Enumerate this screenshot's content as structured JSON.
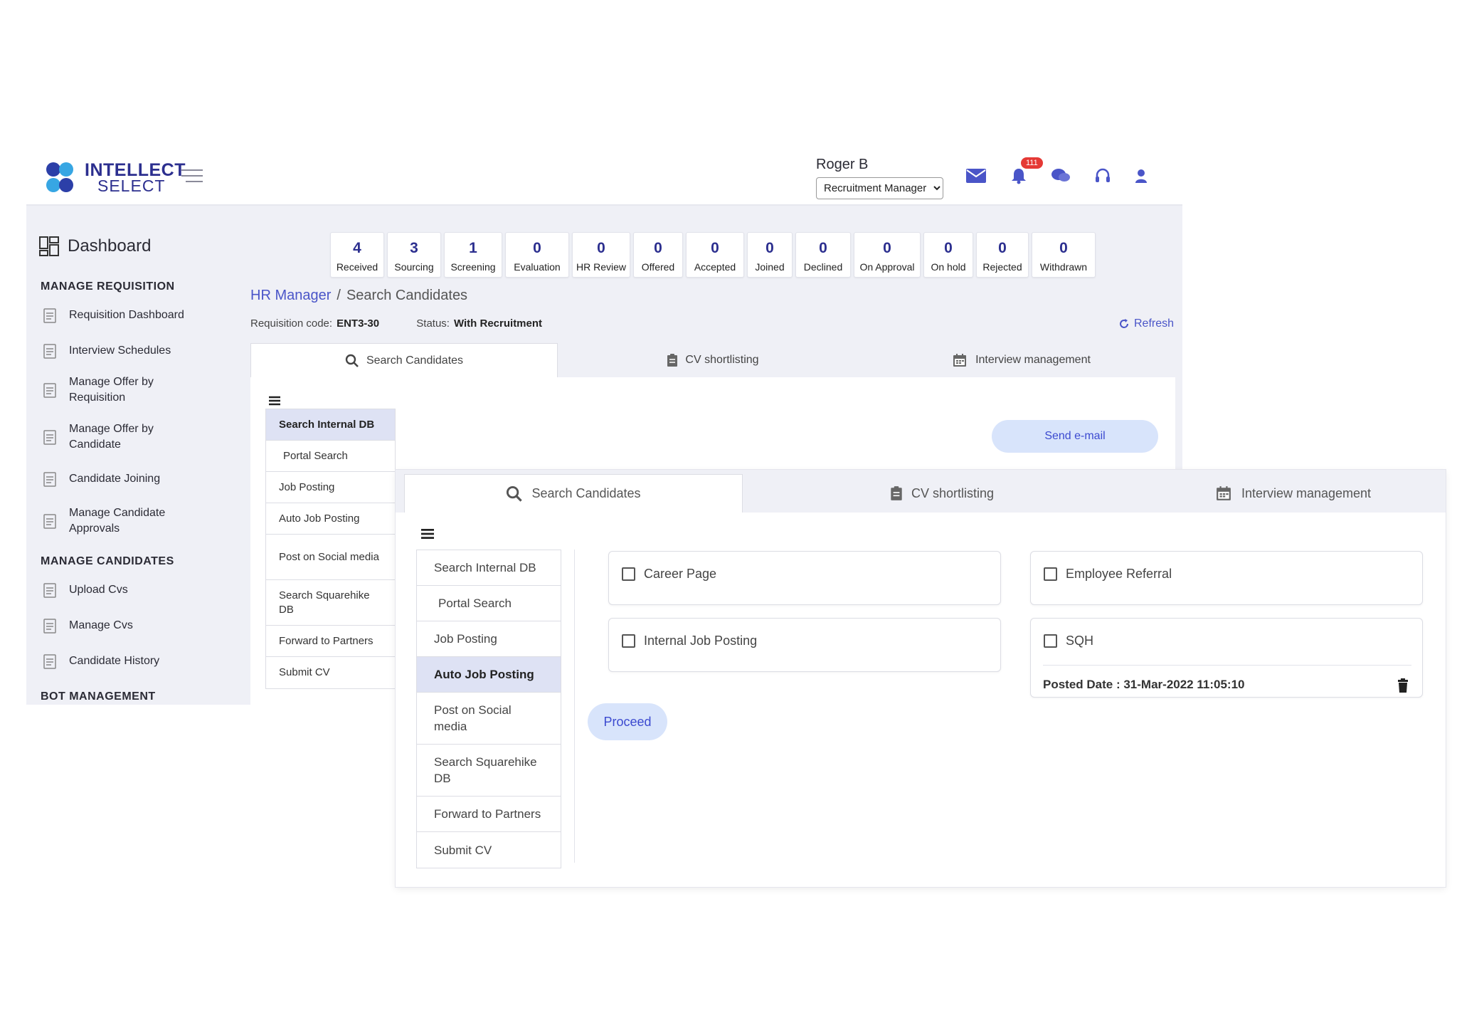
{
  "header": {
    "logo_line1": "INTELLECT",
    "logo_line2": "SELECT",
    "user_name": "Roger B",
    "role_selected": "Recruitment Manager",
    "notification_count": "111"
  },
  "sidebar": {
    "dashboard_label": "Dashboard",
    "sections": [
      {
        "title": "MANAGE REQUISITION"
      },
      {
        "title": "MANAGE CANDIDATES"
      },
      {
        "title": "BOT MANAGEMENT"
      }
    ],
    "items": [
      {
        "label": "Requisition Dashboard"
      },
      {
        "label": "Interview Schedules"
      },
      {
        "label": "Manage Offer by Requisition"
      },
      {
        "label": "Manage Offer by Candidate"
      },
      {
        "label": "Candidate Joining"
      },
      {
        "label": "Manage Candidate Approvals"
      },
      {
        "label": "Upload Cvs"
      },
      {
        "label": "Manage Cvs"
      },
      {
        "label": "Candidate History"
      }
    ]
  },
  "stats": [
    {
      "count": "4",
      "label": "Received"
    },
    {
      "count": "3",
      "label": "Sourcing"
    },
    {
      "count": "1",
      "label": "Screening"
    },
    {
      "count": "0",
      "label": "Evaluation"
    },
    {
      "count": "0",
      "label": "HR Review"
    },
    {
      "count": "0",
      "label": "Offered"
    },
    {
      "count": "0",
      "label": "Accepted"
    },
    {
      "count": "0",
      "label": "Joined"
    },
    {
      "count": "0",
      "label": "Declined"
    },
    {
      "count": "0",
      "label": "On Approval"
    },
    {
      "count": "0",
      "label": "On hold"
    },
    {
      "count": "0",
      "label": "Rejected"
    },
    {
      "count": "0",
      "label": "Withdrawn"
    }
  ],
  "breadcrumb": {
    "parent": "HR Manager",
    "separator": "/",
    "current": "Search Candidates"
  },
  "requisition": {
    "code_label": "Requisition code:",
    "code_value": "ENT3-30",
    "status_label": "Status:",
    "status_value": "With Recruitment",
    "refresh_label": "Refresh"
  },
  "tabs": {
    "search": "Search Candidates",
    "cv": "CV shortlisting",
    "interview": "Interview management"
  },
  "left_menu": [
    {
      "label": "Search Internal DB"
    },
    {
      "label": "Portal Search"
    },
    {
      "label": "Job Posting"
    },
    {
      "label": "Auto Job Posting"
    },
    {
      "label": "Post on Social media"
    },
    {
      "label": "Search Squarehike DB"
    },
    {
      "label": "Forward to Partners"
    },
    {
      "label": "Submit CV"
    }
  ],
  "back_panel": {
    "send_email": "Send e-mail",
    "active_item": "Search Internal DB"
  },
  "front_panel": {
    "active_item": "Auto Job Posting",
    "options": {
      "career_page": "Career Page",
      "employee_referral": "Employee Referral",
      "internal_job_posting": "Internal Job Posting",
      "sqh": "SQH"
    },
    "posted_date": "Posted Date : 31-Mar-2022 11:05:10",
    "proceed": "Proceed"
  },
  "colors": {
    "accent": "#4a55c8",
    "brand": "#2c2f8f",
    "background": "#eff0f6",
    "pill": "#d8e4fb",
    "badge": "#e53935"
  }
}
